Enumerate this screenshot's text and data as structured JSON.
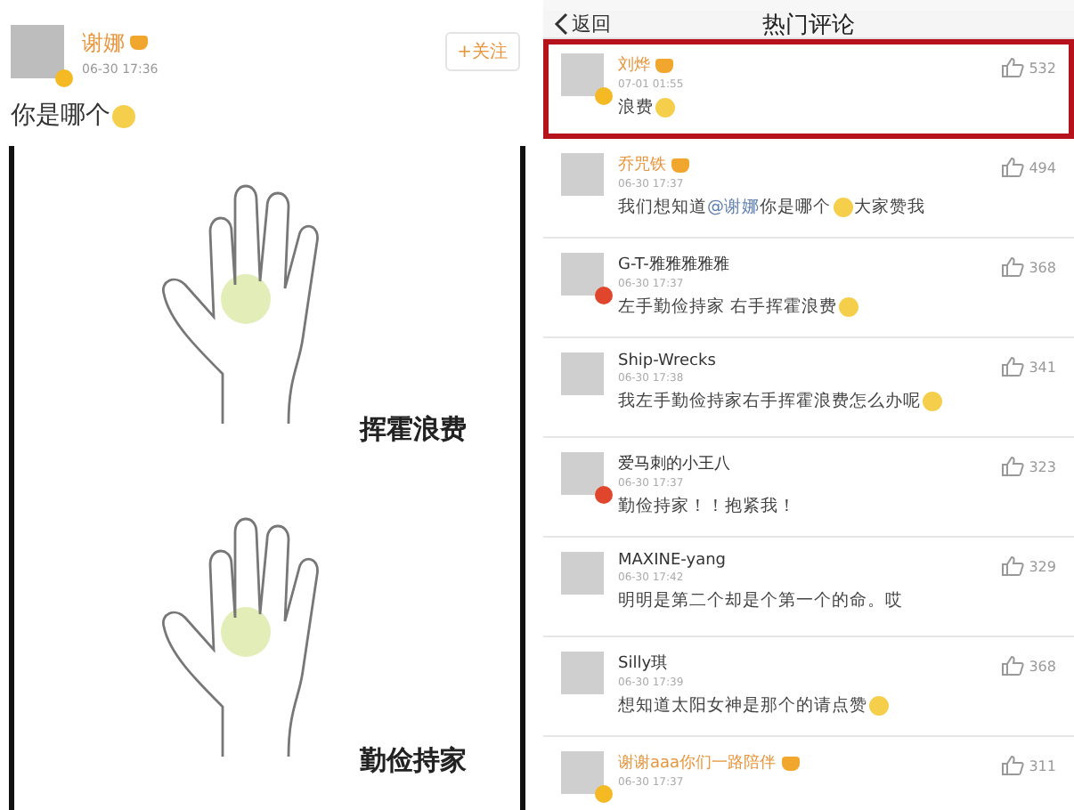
{
  "post": {
    "author": "谢娜",
    "vip": true,
    "badge": {
      "color": "#f4b923"
    },
    "time": "06-30 17:36",
    "follow_button": "+关注",
    "text": [
      {
        "kind": "text",
        "text": "你是哪个"
      },
      {
        "kind": "emoji"
      }
    ],
    "image_labels": [
      "挥霍浪费",
      "勤俭持家"
    ]
  },
  "comments_page": {
    "back": "返回",
    "title": "热门评论",
    "comments": [
      {
        "name": "刘烨",
        "vip": true,
        "badge": {
          "color": "#f4b923"
        },
        "time": "07-01 01:55",
        "likes": "532",
        "highlighted": true,
        "parts": [
          {
            "kind": "text",
            "text": "浪费"
          },
          {
            "kind": "emoji"
          }
        ]
      },
      {
        "name": "乔咒铁",
        "vip": true,
        "time": "06-30 17:37",
        "likes": "494",
        "highlighted": false,
        "parts": [
          {
            "kind": "text",
            "text": "我们想知道"
          },
          {
            "kind": "mention",
            "text": "@谢娜"
          },
          {
            "kind": "text",
            "text": " 你是哪个"
          },
          {
            "kind": "emoji"
          },
          {
            "kind": "text",
            "text": "大家赞我"
          }
        ]
      },
      {
        "name": "G-T-雅雅雅雅雅",
        "vip": false,
        "badge": {
          "color": "#e0462c"
        },
        "time": "06-30 17:37",
        "likes": "368",
        "highlighted": false,
        "parts": [
          {
            "kind": "text",
            "text": "左手勤俭持家 右手挥霍浪费"
          },
          {
            "kind": "emoji"
          }
        ]
      },
      {
        "name": "Ship-Wrecks",
        "vip": false,
        "time": "06-30 17:38",
        "likes": "341",
        "highlighted": false,
        "parts": [
          {
            "kind": "text",
            "text": "我左手勤俭持家右手挥霍浪费怎么办呢"
          },
          {
            "kind": "emoji"
          }
        ]
      },
      {
        "name": "爱马刺的小王八",
        "vip": false,
        "badge": {
          "color": "#e0462c"
        },
        "time": "06-30 17:37",
        "likes": "323",
        "highlighted": false,
        "parts": [
          {
            "kind": "text",
            "text": "勤俭持家！！抱紧我！"
          }
        ]
      },
      {
        "name": "MAXINE-yang",
        "vip": false,
        "time": "06-30 17:42",
        "likes": "329",
        "highlighted": false,
        "parts": [
          {
            "kind": "text",
            "text": "明明是第二个却是个第一个的命。哎"
          }
        ]
      },
      {
        "name": "Silly琪",
        "vip": false,
        "time": "06-30 17:39",
        "likes": "368",
        "highlighted": false,
        "parts": [
          {
            "kind": "text",
            "text": "想知道太阳女神是那个的请点赞"
          },
          {
            "kind": "emoji"
          }
        ]
      },
      {
        "name": "谢谢aaa你们一路陪伴",
        "vip": true,
        "badge": {
          "color": "#f4b923"
        },
        "time": "06-30 17:37",
        "likes": "311",
        "highlighted": false
      }
    ]
  }
}
